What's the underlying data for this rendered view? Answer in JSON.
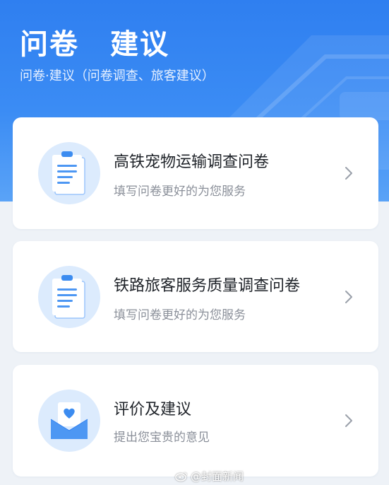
{
  "header": {
    "title_part1": "问卷",
    "title_part2": "建议",
    "subtitle": "问卷·建议（问卷调查、旅客建议）"
  },
  "cards": [
    {
      "title": "高铁宠物运输调查问卷",
      "subtitle": "填写问卷更好的为您服务",
      "icon": "questionnaire-clipboard-icon"
    },
    {
      "title": "铁路旅客服务质量调查问卷",
      "subtitle": "填写问卷更好的为您服务",
      "icon": "questionnaire-clipboard-icon"
    },
    {
      "title": "评价及建议",
      "subtitle": "提出您宝贵的意见",
      "icon": "heart-envelope-icon"
    }
  ],
  "watermark": {
    "text": "@封面新闻"
  },
  "colors": {
    "header_blue": "#2f7ff0",
    "icon_blue": "#3c8cf0",
    "icon_bg": "#dcebfd",
    "title_text": "#1f2329",
    "subtitle_text": "#8a8f99"
  }
}
